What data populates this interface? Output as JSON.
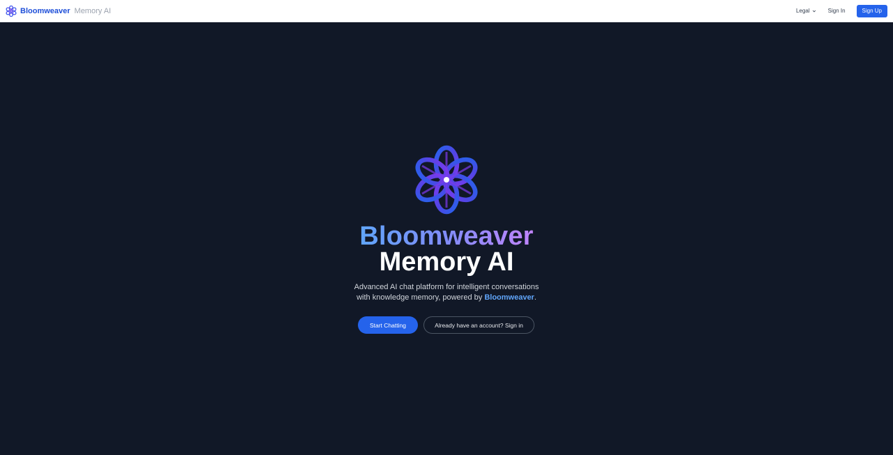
{
  "header": {
    "brand_name": "Bloomweaver",
    "product_name": "Memory AI",
    "logo_icon": "flower-logo-icon",
    "legal_label": "Legal",
    "signin_label": "Sign In",
    "signup_label": "Sign Up"
  },
  "hero": {
    "logo_icon": "flower-logo-icon",
    "title_line1": "Bloomweaver",
    "title_line2": "Memory AI",
    "subtitle_line1": "Advanced AI chat platform for intelligent conversations",
    "subtitle_line2_prefix": "with knowledge memory, powered by ",
    "subtitle_highlight": "Bloomweaver",
    "subtitle_suffix": ".",
    "primary_cta": "Start Chatting",
    "secondary_cta": "Already have an account? Sign in"
  },
  "colors": {
    "background": "#111827",
    "accent": "#2563eb",
    "brand_blue": "#1d4ed8",
    "gradient_start": "#60a5fa",
    "gradient_end": "#c084fc"
  }
}
